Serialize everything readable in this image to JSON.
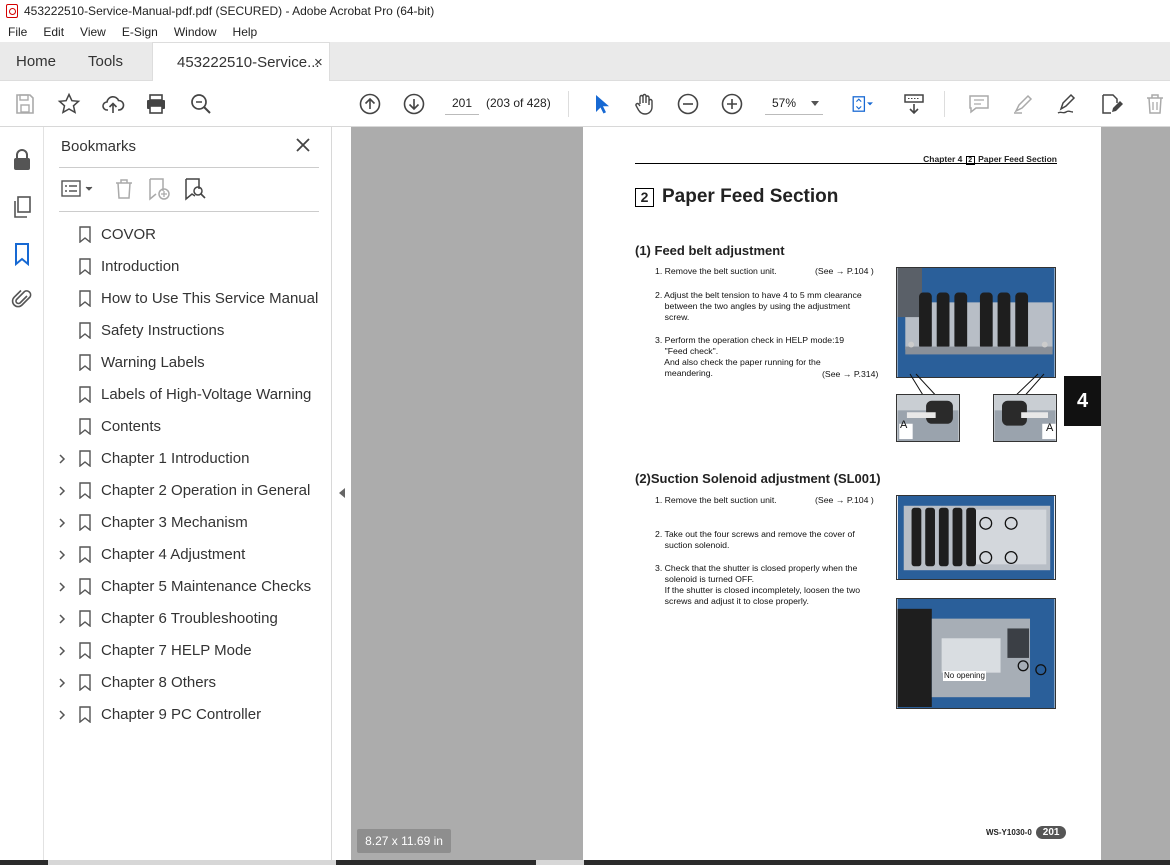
{
  "window": {
    "title": "453222510-Service-Manual-pdf.pdf (SECURED) - Adobe Acrobat Pro (64-bit)"
  },
  "menu": [
    "File",
    "Edit",
    "View",
    "E-Sign",
    "Window",
    "Help"
  ],
  "tabs": {
    "home": "Home",
    "tools": "Tools",
    "document": "453222510-Service...",
    "close": "×"
  },
  "toolbar": {
    "page_number": "201",
    "page_count": "(203 of 428)",
    "zoom": "57%"
  },
  "bookmarks": {
    "title": "Bookmarks",
    "items": [
      {
        "label": "COVOR",
        "expandable": false
      },
      {
        "label": "Introduction",
        "expandable": false
      },
      {
        "label": "How to Use This Service Manual",
        "expandable": false
      },
      {
        "label": "Safety Instructions",
        "expandable": false
      },
      {
        "label": "Warning Labels",
        "expandable": false
      },
      {
        "label": "Labels of High-Voltage Warning",
        "expandable": false
      },
      {
        "label": "Contents",
        "expandable": false
      },
      {
        "label": "Chapter 1 Introduction",
        "expandable": true
      },
      {
        "label": "Chapter 2 Operation in General",
        "expandable": true
      },
      {
        "label": "Chapter 3 Mechanism",
        "expandable": true
      },
      {
        "label": "Chapter 4 Adjustment",
        "expandable": true
      },
      {
        "label": "Chapter 5 Maintenance Checks",
        "expandable": true
      },
      {
        "label": "Chapter 6 Troubleshooting",
        "expandable": true
      },
      {
        "label": "Chapter 7 HELP Mode",
        "expandable": true
      },
      {
        "label": "Chapter 8 Others",
        "expandable": true
      },
      {
        "label": "Chapter 9 PC Controller",
        "expandable": true
      }
    ]
  },
  "viewer": {
    "page_size": "8.27 x 11.69 in",
    "chapter_tab": "4"
  },
  "doc": {
    "header_left": "Chapter 4",
    "header_box": "2",
    "header_right": "Paper Feed Section",
    "title_box": "2",
    "title": "Paper Feed Section",
    "sec1_title": "(1) Feed belt adjustment",
    "sec1_step1": "1. Remove the belt suction unit.",
    "sec1_step1_ref": "(See → P.104 )",
    "sec1_step2": "2. Adjust the belt tension to have 4 to 5 mm clearance\n    between the two angles by using the adjustment\n    screw.",
    "sec1_step3": "3. Perform the operation check in HELP mode:19\n    \"Feed check\".\n    And also check the paper running for the\n    meandering.",
    "sec1_step3_ref": "(See → P.314)",
    "label_a_left": "A",
    "label_a_right": "A",
    "sec2_title": "(2)Suction Solenoid adjustment (SL001)",
    "sec2_step1": "1. Remove the belt suction unit.",
    "sec2_step1_ref": "(See → P.104 )",
    "sec2_step2": "2. Take out the four screws and remove the cover of\n    suction solenoid.",
    "sec2_step3": "3. Check that the shutter is closed properly when the\n    solenoid is turned OFF.\n    If the shutter is closed incompletely, loosen the two\n    screws and adjust it to close properly.",
    "photo_label": "No opening",
    "footer_code": "WS-Y1030-0",
    "footer_page": "201"
  }
}
